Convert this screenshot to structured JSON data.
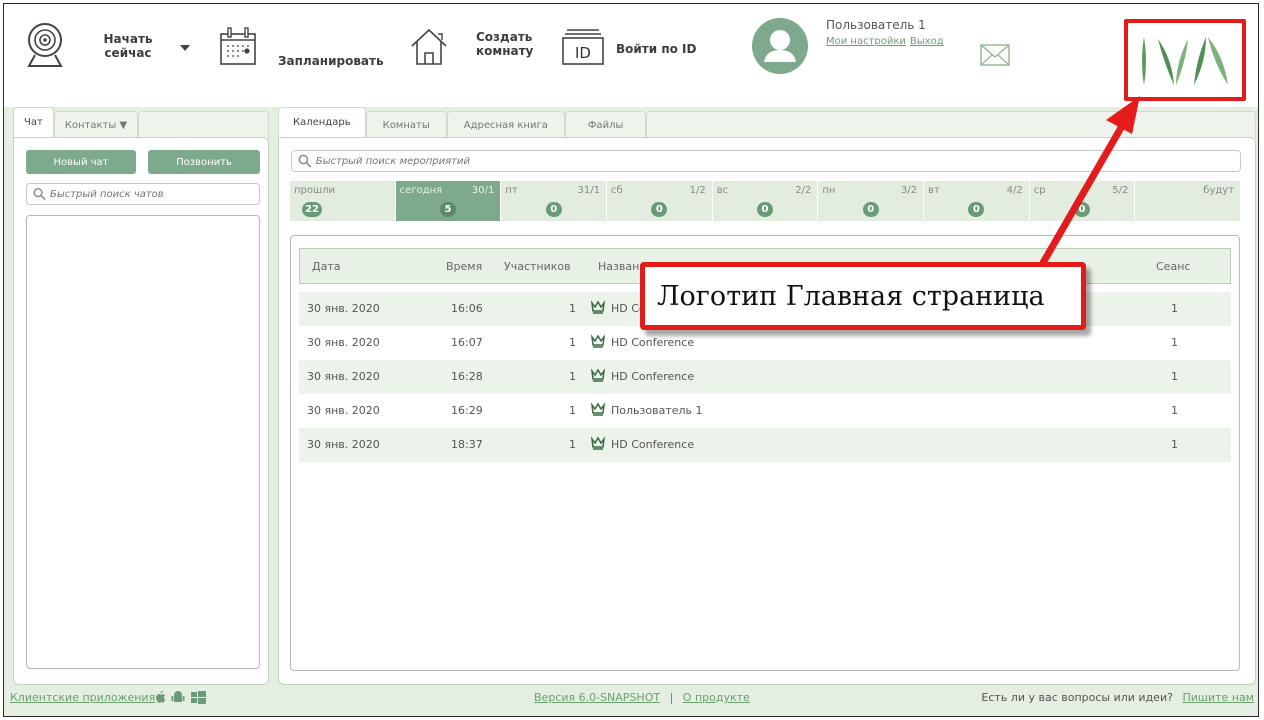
{
  "header": {
    "start_now_label": "Начать сейчас",
    "start_now_line1": "Начать",
    "start_now_line2": "сейчас",
    "schedule_label": "Запланировать",
    "create_room_line1": "Создать",
    "create_room_line2": "комнату",
    "id_badge": "ID",
    "join_by_id_label": "Войти по ID",
    "user_name": "Пользователь 1",
    "my_settings_link": "Мои настройки",
    "logout_link": "Выход",
    "logo_icon": "iva-logo",
    "accent_color": "#7ea98c"
  },
  "left_panel": {
    "tabs": [
      {
        "label": "Чат"
      },
      {
        "label": "Контакты ▼"
      }
    ],
    "new_chat_button": "Новый чат",
    "call_button": "Позвонить",
    "search_placeholder": "Быстрый поиск чатов"
  },
  "right_panel": {
    "tabs": [
      {
        "label": "Календарь"
      },
      {
        "label": "Комнаты"
      },
      {
        "label": "Адресная книга"
      },
      {
        "label": "Файлы"
      }
    ],
    "search_placeholder": "Быстрый поиск мероприятий",
    "days": [
      {
        "name": "прошли",
        "date": "",
        "count": "22"
      },
      {
        "name": "сегодня",
        "date": "30/1",
        "count": "5"
      },
      {
        "name": "пт",
        "date": "31/1",
        "count": "0"
      },
      {
        "name": "сб",
        "date": "1/2",
        "count": "0"
      },
      {
        "name": "вс",
        "date": "2/2",
        "count": "0"
      },
      {
        "name": "пн",
        "date": "3/2",
        "count": "0"
      },
      {
        "name": "вт",
        "date": "4/2",
        "count": "0"
      },
      {
        "name": "ср",
        "date": "5/2",
        "count": "0"
      },
      {
        "name": "будут",
        "date": "",
        "count": ""
      }
    ],
    "table": {
      "headers": {
        "date": "Дата",
        "time": "Время",
        "participants": "Участников",
        "name": "Название",
        "session": "Сеанс"
      },
      "rows": [
        {
          "date": "30 янв. 2020",
          "time": "16:06",
          "participants": "1",
          "name": "HD Conference",
          "session": "1"
        },
        {
          "date": "30 янв. 2020",
          "time": "16:07",
          "participants": "1",
          "name": "HD Conference",
          "session": "1"
        },
        {
          "date": "30 янв. 2020",
          "time": "16:28",
          "participants": "1",
          "name": "HD Conference",
          "session": "1"
        },
        {
          "date": "30 янв. 2020",
          "time": "16:29",
          "participants": "1",
          "name": "Пользователь 1",
          "session": "1"
        },
        {
          "date": "30 янв. 2020",
          "time": "18:37",
          "participants": "1",
          "name": "HD Conference",
          "session": "1"
        }
      ]
    }
  },
  "footer": {
    "client_apps_link": "Клиентские приложения",
    "version_link": "Версия 6.0-SNAPSHOT",
    "separator": "|",
    "about_link": "О продукте",
    "question_text": "Есть ли у вас вопросы или идеи?",
    "write_us_link": "Пишите нам"
  },
  "annotation": {
    "callout_text": "Логотип Главная страница",
    "color": "#e31b1b"
  }
}
